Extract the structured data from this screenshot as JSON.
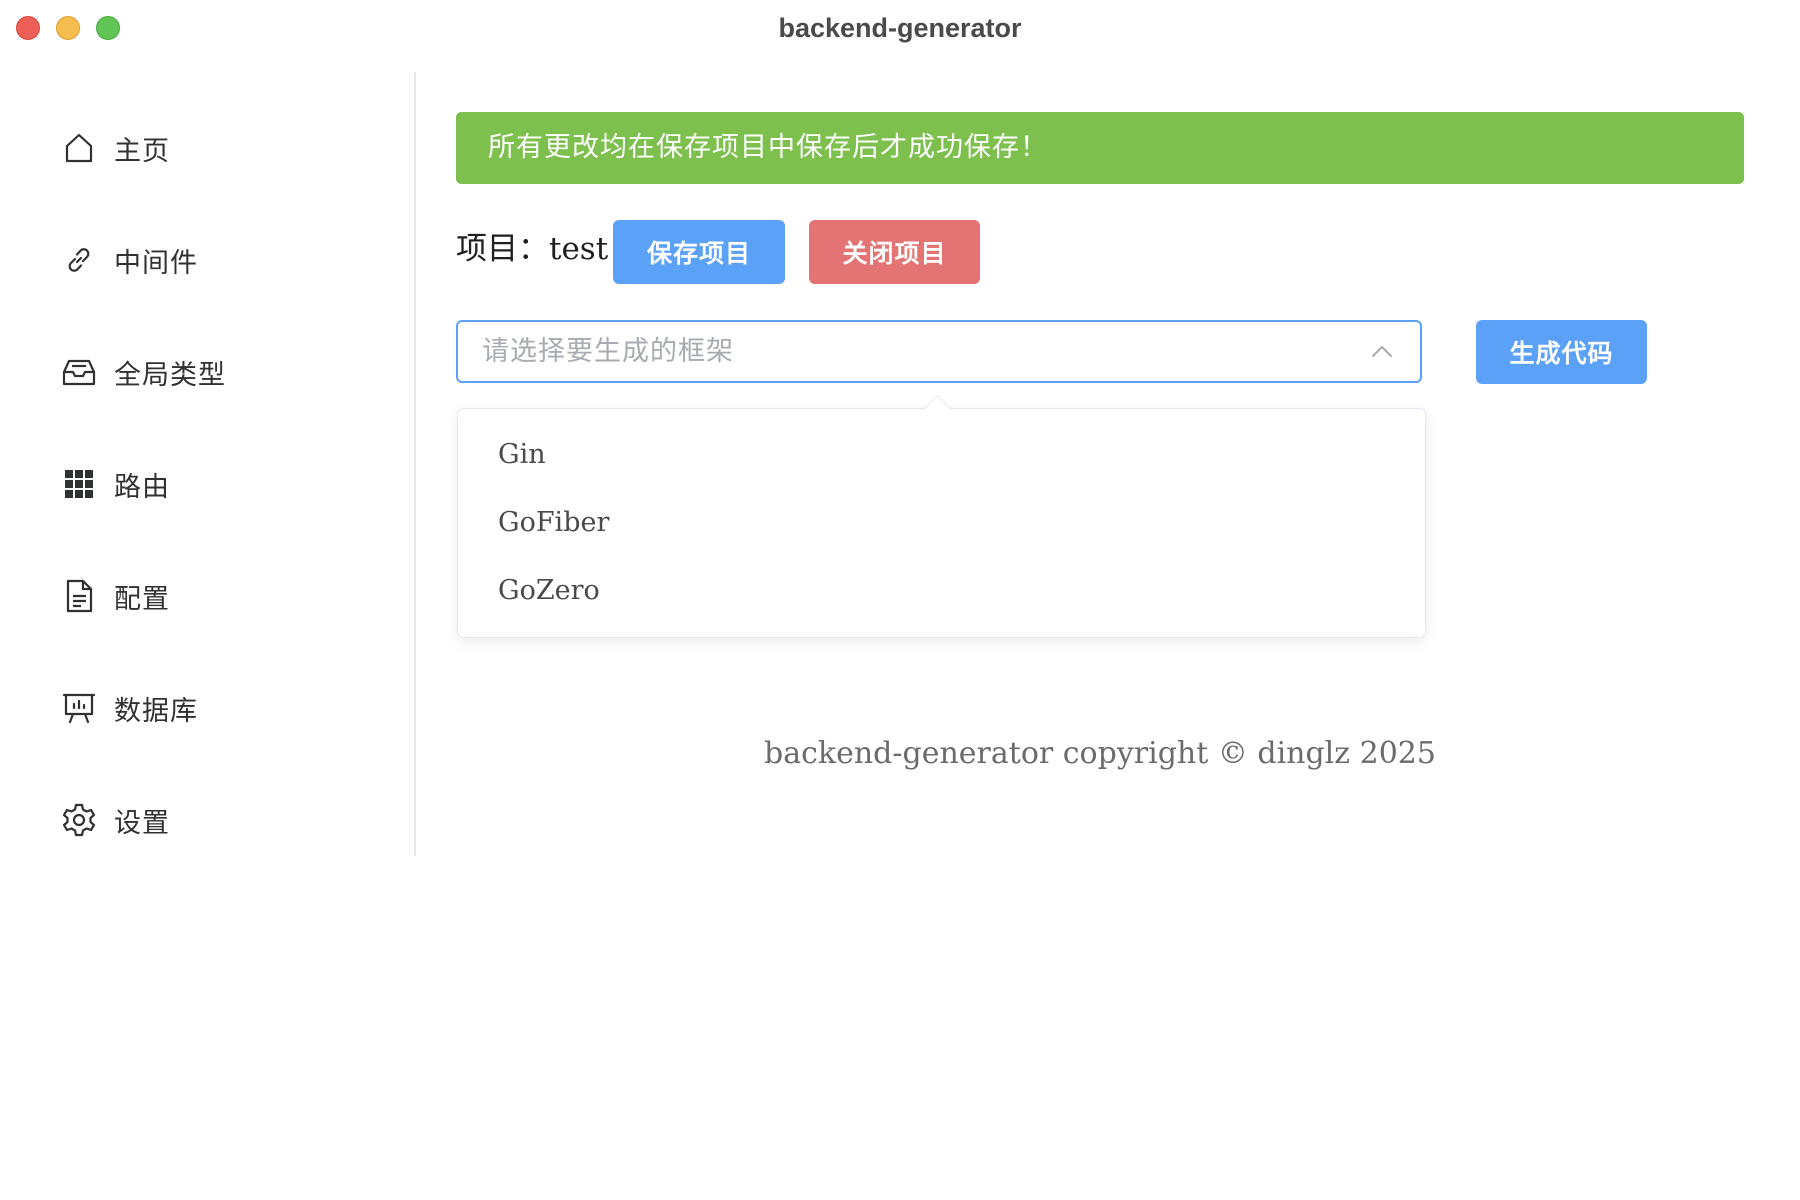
{
  "window": {
    "title": "backend-generator"
  },
  "sidebar": {
    "items": [
      {
        "label": "主页",
        "icon": "home-icon"
      },
      {
        "label": "中间件",
        "icon": "link-icon"
      },
      {
        "label": "全局类型",
        "icon": "inbox-icon"
      },
      {
        "label": "路由",
        "icon": "grid-icon"
      },
      {
        "label": "配置",
        "icon": "document-icon"
      },
      {
        "label": "数据库",
        "icon": "presentation-icon"
      },
      {
        "label": "设置",
        "icon": "gear-icon"
      }
    ]
  },
  "main": {
    "alert": "所有更改均在保存项目中保存后才成功保存！",
    "project_label": "项目：test",
    "save_button": "保存项目",
    "close_button": "关闭项目",
    "framework_select": {
      "placeholder": "请选择要生成的框架",
      "expanded": true,
      "options": [
        "Gin",
        "GoFiber",
        "GoZero"
      ]
    },
    "generate_button": "生成代码",
    "footer": "backend-generator copyright © dinglz 2025"
  },
  "colors": {
    "primary": "#5ca1f8",
    "danger": "#e47474",
    "success_alert": "#7dc04e",
    "select_border": "#5ca1f8",
    "placeholder": "#a8abb2"
  }
}
